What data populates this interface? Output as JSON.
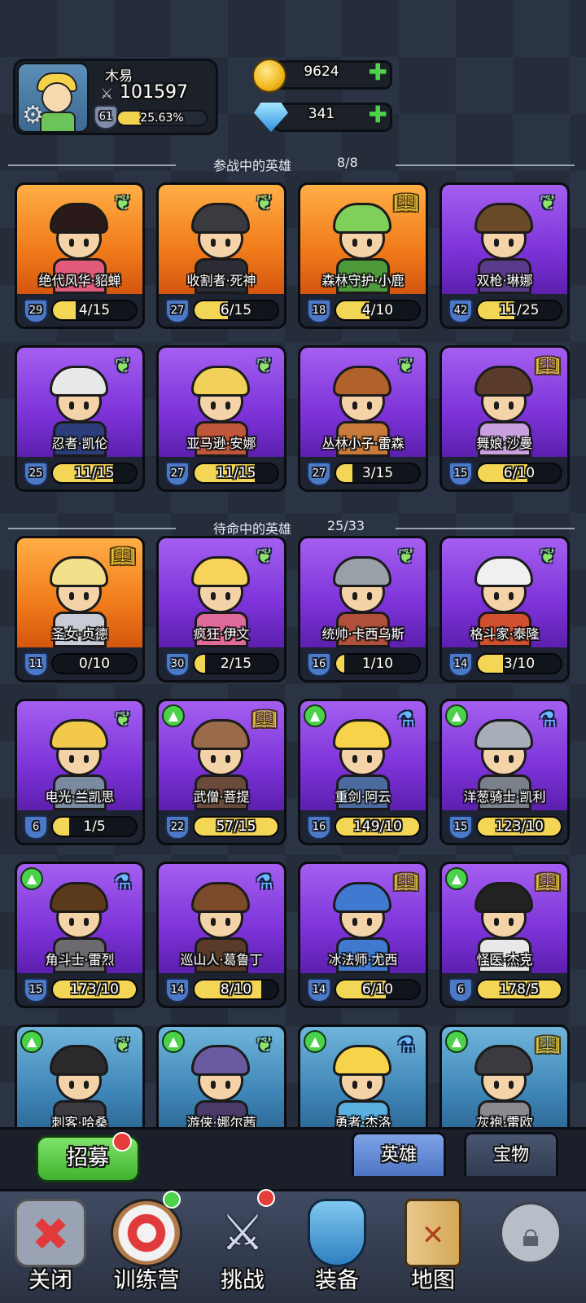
{
  "player": {
    "name": "木易",
    "power": "101597",
    "level": "61",
    "exp_percent_text": "25.63%",
    "exp_fraction": 0.2563
  },
  "resources": {
    "gold": "9624",
    "gems": "341"
  },
  "sections": {
    "active_title": "参战中的英雄",
    "active_count": "8/8",
    "standby_title": "待命中的英雄",
    "standby_count": "25/33"
  },
  "active_heroes": [
    {
      "name": "绝代风华·貂蝉",
      "level": "29",
      "progress": "4/15",
      "fill": 0.27,
      "bg": "orange",
      "badge": "wing",
      "up": false,
      "hair": "#2a1a1a",
      "body": "#e25b7a"
    },
    {
      "name": "收割者·死神",
      "level": "27",
      "progress": "6/15",
      "fill": 0.4,
      "bg": "orange",
      "badge": "wing",
      "up": false,
      "hair": "#3a3a40",
      "body": "#2d2d35"
    },
    {
      "name": "森林守护·小鹿",
      "level": "18",
      "progress": "4/10",
      "fill": 0.4,
      "bg": "orange",
      "badge": "book",
      "up": false,
      "hair": "#7fd05a",
      "body": "#4e9a3a"
    },
    {
      "name": "双枪·琳娜",
      "level": "42",
      "progress": "11/25",
      "fill": 0.44,
      "bg": "purple",
      "badge": "wing",
      "up": false,
      "hair": "#6b4a2a",
      "body": "#5a3a8a"
    },
    {
      "name": "忍者·凯伦",
      "level": "25",
      "progress": "11/15",
      "fill": 0.73,
      "bg": "purple",
      "badge": "wing",
      "up": false,
      "hair": "#e8e8e8",
      "body": "#2b3d7a"
    },
    {
      "name": "亚马逊·安娜",
      "level": "27",
      "progress": "11/15",
      "fill": 0.73,
      "bg": "purple",
      "badge": "wing",
      "up": false,
      "hair": "#f2d15a",
      "body": "#c0563a"
    },
    {
      "name": "丛林小子·雷森",
      "level": "27",
      "progress": "3/15",
      "fill": 0.2,
      "bg": "purple",
      "badge": "wing",
      "up": false,
      "hair": "#b0622a",
      "body": "#c97a3a"
    },
    {
      "name": "舞娘·沙曼",
      "level": "15",
      "progress": "6/10",
      "fill": 0.6,
      "bg": "purple",
      "badge": "book",
      "up": false,
      "hair": "#5a3a2a",
      "body": "#c9a0e0"
    }
  ],
  "standby_heroes": [
    {
      "name": "圣女·贞德",
      "level": "11",
      "progress": "0/10",
      "fill": 0,
      "bg": "orange",
      "badge": "book",
      "up": false,
      "hair": "#f2e08a",
      "body": "#c9ccd6"
    },
    {
      "name": "疯狂·伊文",
      "level": "30",
      "progress": "2/15",
      "fill": 0.13,
      "bg": "purple",
      "badge": "wing",
      "up": false,
      "hair": "#f7d35a",
      "body": "#e06a9a"
    },
    {
      "name": "统帅·卡西乌斯",
      "level": "16",
      "progress": "1/10",
      "fill": 0.1,
      "bg": "purple",
      "badge": "wing",
      "up": false,
      "hair": "#9aa0a8",
      "body": "#b0503a"
    },
    {
      "name": "格斗家·泰隆",
      "level": "14",
      "progress": "3/10",
      "fill": 0.3,
      "bg": "purple",
      "badge": "wing",
      "up": false,
      "hair": "#f0f0f0",
      "body": "#d05030"
    },
    {
      "name": "电光·兰凯思",
      "level": "6",
      "progress": "1/5",
      "fill": 0.2,
      "bg": "purple",
      "badge": "wing",
      "up": false,
      "hair": "#f2c94a",
      "body": "#7a8aa0"
    },
    {
      "name": "武僧·菩提",
      "level": "22",
      "progress": "57/15",
      "fill": 1,
      "bg": "purple",
      "badge": "book",
      "up": true,
      "hair": "#9a6a4a",
      "body": "#6a4a3a"
    },
    {
      "name": "重剑·阿云",
      "level": "16",
      "progress": "149/10",
      "fill": 1,
      "bg": "purple",
      "badge": "potion",
      "up": true,
      "hair": "#f7d34a",
      "body": "#4a6aa0"
    },
    {
      "name": "洋葱骑士·凯利",
      "level": "15",
      "progress": "123/10",
      "fill": 1,
      "bg": "purple",
      "badge": "potion",
      "up": true,
      "hair": "#a8aeb8",
      "body": "#7a808a"
    },
    {
      "name": "角斗士·雷烈",
      "level": "15",
      "progress": "173/10",
      "fill": 1,
      "bg": "purple",
      "badge": "potion",
      "up": true,
      "hair": "#5a3a1a",
      "body": "#6a6a70"
    },
    {
      "name": "巡山人·葛鲁丁",
      "level": "14",
      "progress": "8/10",
      "fill": 0.8,
      "bg": "purple",
      "badge": "potion",
      "up": false,
      "hair": "#7a4a2a",
      "body": "#5a3a28"
    },
    {
      "name": "冰法师·尤西",
      "level": "14",
      "progress": "6/10",
      "fill": 0.6,
      "bg": "purple",
      "badge": "book",
      "up": false,
      "hair": "#3f7ad0",
      "body": "#3f7ad0"
    },
    {
      "name": "怪医·杰克",
      "level": "6",
      "progress": "178/5",
      "fill": 1,
      "bg": "purple",
      "badge": "book",
      "up": true,
      "hair": "#222222",
      "body": "#e8e8e8"
    },
    {
      "name": "刺客·哈桑",
      "level": "",
      "progress": "",
      "fill": 0,
      "bg": "blue",
      "badge": "wing",
      "up": true,
      "hair": "#2a2a2a",
      "body": "#3a3a40"
    },
    {
      "name": "游侠·娜尔茜",
      "level": "",
      "progress": "",
      "fill": 0,
      "bg": "blue",
      "badge": "wing",
      "up": true,
      "hair": "#6a5aa0",
      "body": "#4a3a6a"
    },
    {
      "name": "勇者·杰洛",
      "level": "",
      "progress": "",
      "fill": 0,
      "bg": "blue",
      "badge": "potion",
      "up": true,
      "hair": "#f7d34a",
      "body": "#5ab0e0"
    },
    {
      "name": "灰袍·雷欧",
      "level": "",
      "progress": "",
      "fill": 0,
      "bg": "blue",
      "badge": "book",
      "up": true,
      "hair": "#3a3a40",
      "body": "#8a8a90"
    }
  ],
  "buttons": {
    "recruit": "招募"
  },
  "tabs": {
    "heroes": "英雄",
    "treasure": "宝物"
  },
  "nav": [
    {
      "label": "关闭",
      "icon": "close-icon"
    },
    {
      "label": "训练营",
      "icon": "target-icon"
    },
    {
      "label": "挑战",
      "icon": "sword-icon"
    },
    {
      "label": "装备",
      "icon": "armor-icon"
    },
    {
      "label": "地图",
      "icon": "map-icon"
    },
    {
      "label": "",
      "icon": "lock-icon"
    }
  ]
}
